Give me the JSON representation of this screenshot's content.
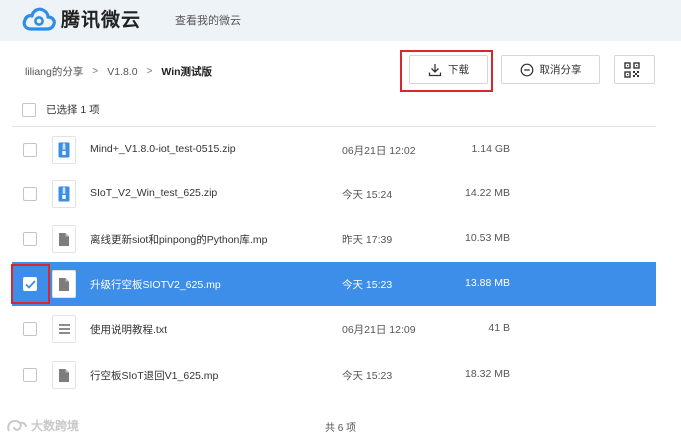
{
  "header": {
    "logo_text": "腾讯微云",
    "subtitle": "查看我的微云"
  },
  "breadcrumb": [
    "liliang的分享",
    "V1.8.0",
    "Win测试版"
  ],
  "toolbar": {
    "download_label": "下载",
    "cancel_share_label": "取消分享",
    "qr_icon": "qr-code-icon"
  },
  "selection": {
    "label": "已选择 1 项"
  },
  "files": [
    {
      "name": "Mind+_V1.8.0-iot_test-0515.zip",
      "date": "06月21日 12:02",
      "size": "1.14 GB",
      "type": "zip",
      "selected": false
    },
    {
      "name": "SIoT_V2_Win_test_625.zip",
      "date": "今天 15:24",
      "size": "14.22 MB",
      "type": "zip",
      "selected": false
    },
    {
      "name": "离线更新siot和pinpong的Python库.mp",
      "date": "昨天 17:39",
      "size": "10.53 MB",
      "type": "file",
      "selected": false
    },
    {
      "name": "升级行空板SIOTV2_625.mp",
      "date": "今天 15:23",
      "size": "13.88 MB",
      "type": "file",
      "selected": true
    },
    {
      "name": "使用说明教程.txt",
      "date": "06月21日 12:09",
      "size": "41 B",
      "type": "txt",
      "selected": false
    },
    {
      "name": "行空板SIoT退回V1_625.mp",
      "date": "今天 15:23",
      "size": "18.32 MB",
      "type": "file",
      "selected": false
    }
  ],
  "footer": {
    "count_label": "共 6 项"
  },
  "watermark": {
    "text": "大数跨境"
  },
  "colors": {
    "accent": "#3d8ee8",
    "highlight": "#d9272e",
    "header_bg": "#eef3f8",
    "zip_icon": "#3a8ee6"
  }
}
